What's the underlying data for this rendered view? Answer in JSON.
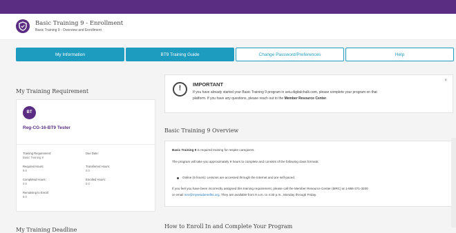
{
  "topbar": {
    "brand": ""
  },
  "header": {
    "title": "Basic Training 9 - Enrollment",
    "subtitle": "Basic Training 9 - Overview and Enrollment"
  },
  "tabs": [
    {
      "label": "My Information",
      "style": "filled"
    },
    {
      "label": "BT9 Training Guide",
      "style": "filled"
    },
    {
      "label": "Change Password/Preferences",
      "style": "outline"
    },
    {
      "label": "Help",
      "style": "outline"
    }
  ],
  "left": {
    "section_title": "My Training Requirement",
    "deadline_title": "My Training Deadline",
    "card": {
      "initials": "BT",
      "name": "Reg-CG-16-BT9 Tester",
      "fields": {
        "training_requirement_label": "Training Requirement:",
        "training_requirement_value": "Basic Training 9",
        "due_date_label": "Due Date:",
        "due_date_value": "",
        "required_hours_label": "Required Hours:",
        "required_hours_value": "9.0",
        "transferred_hours_label": "Transferred Hours:",
        "transferred_hours_value": "0.0",
        "completed_hours_label": "Completed Hours:",
        "completed_hours_value": "0.0",
        "enrolled_hours_label": "Enrolled Hours:",
        "enrolled_hours_value": "0.0",
        "remaining_label": "Remaining to Enroll:",
        "remaining_value": "9.0"
      }
    }
  },
  "important": {
    "title": "IMPORTANT",
    "line1": "If you have already started your Basic Training 9 program in seiu.digitalchalk.com, please complete your program on that",
    "line2_prefix": "platform. If you have any questions, please reach out to the",
    "line2_bold": "Member Resource Center",
    "close_symbol": "×"
  },
  "overview": {
    "title": "Basic Training 9 Overview",
    "p1_bold": "Basic Training 9",
    "p1_rest": " is required training for respite caregivers.",
    "p2": "The program will take you approximately 9 hours to complete and consists of the following class formats:",
    "bullet1": "Online (9 hours): Lessons are accessed through the Internet and are self-paced.",
    "p3_line1": "If you feel you have been incorrectly assigned this training requirement, please call the Member Resource Center (MRC) at 1-866-371-3200",
    "p3_line2_prefix": "or email ",
    "p3_email": "mrc@myseiubenefits.org",
    "p3_line2_suffix": ". They are available from 8 a.m. to 4:30 p.m., Monday through Friday."
  },
  "enroll_title": "How to Enroll In and Complete Your Program",
  "colors": {
    "purple": "#5a2d82",
    "teal": "#1e9cc0",
    "background": "#f4f4f4"
  }
}
